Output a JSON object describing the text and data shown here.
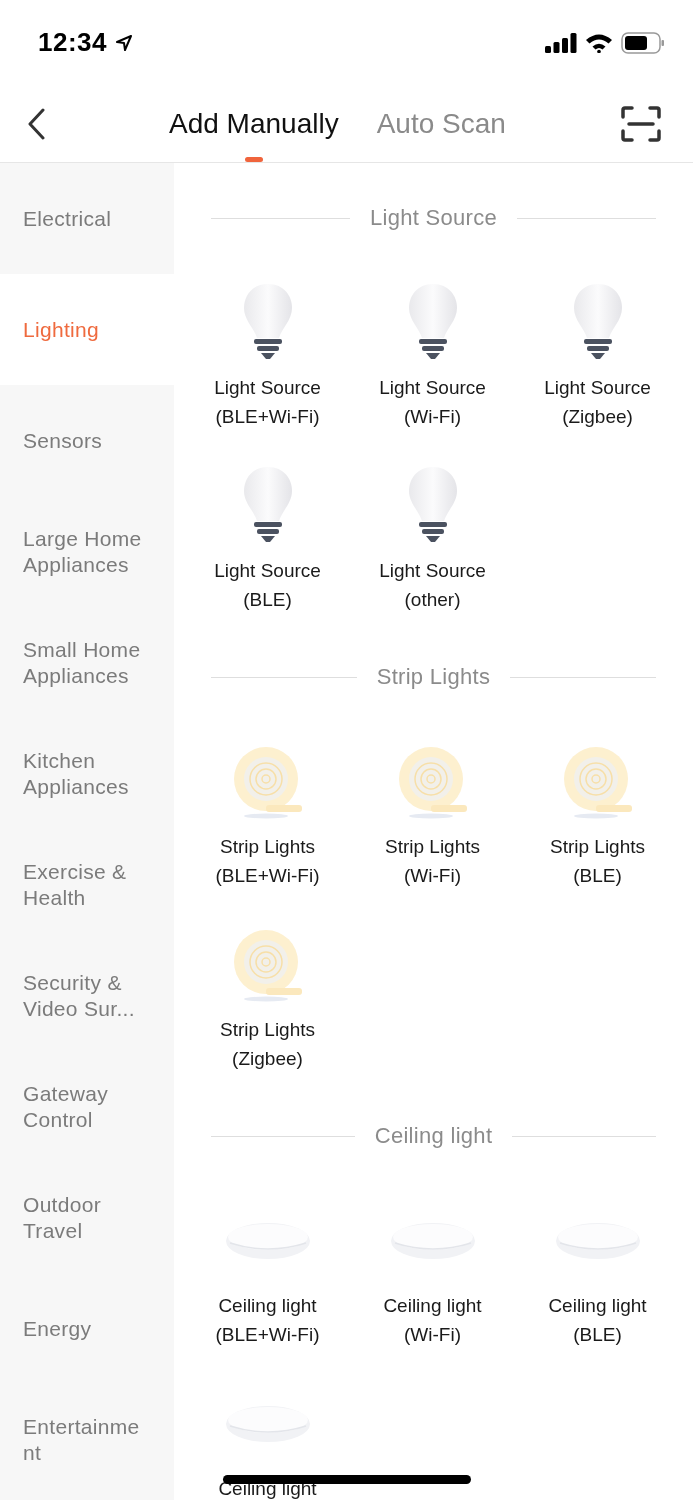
{
  "status_bar": {
    "time": "12:34"
  },
  "tabs": [
    {
      "label": "Add Manually",
      "selected": true
    },
    {
      "label": "Auto Scan",
      "selected": false
    }
  ],
  "sidebar": {
    "items": [
      {
        "label": "Electrical",
        "selected": false
      },
      {
        "label": "Lighting",
        "selected": true
      },
      {
        "label": "Sensors",
        "selected": false
      },
      {
        "label": "Large Home Appliances",
        "selected": false
      },
      {
        "label": "Small Home Appliances",
        "selected": false
      },
      {
        "label": "Kitchen Appliances",
        "selected": false
      },
      {
        "label": "Exercise & Health",
        "selected": false
      },
      {
        "label": "Security & Video Sur...",
        "selected": false
      },
      {
        "label": "Gateway Control",
        "selected": false
      },
      {
        "label": "Outdoor Travel",
        "selected": false
      },
      {
        "label": "Energy",
        "selected": false
      },
      {
        "label": "Entertainment",
        "selected": false
      }
    ]
  },
  "sections": [
    {
      "title": "Light Source",
      "kind": "bulb",
      "devices": [
        {
          "name": "Light Source",
          "variant": "(BLE+Wi-Fi)"
        },
        {
          "name": "Light Source",
          "variant": "(Wi-Fi)"
        },
        {
          "name": "Light Source",
          "variant": "(Zigbee)"
        },
        {
          "name": "Light Source",
          "variant": "(BLE)"
        },
        {
          "name": "Light Source",
          "variant": "(other)"
        }
      ]
    },
    {
      "title": "Strip Lights",
      "kind": "strip",
      "devices": [
        {
          "name": "Strip Lights",
          "variant": "(BLE+Wi-Fi)"
        },
        {
          "name": "Strip Lights",
          "variant": "(Wi-Fi)"
        },
        {
          "name": "Strip Lights",
          "variant": "(BLE)"
        },
        {
          "name": "Strip Lights",
          "variant": "(Zigbee)"
        }
      ]
    },
    {
      "title": "Ceiling light",
      "kind": "ceiling",
      "devices": [
        {
          "name": "Ceiling light",
          "variant": "(BLE+Wi-Fi)"
        },
        {
          "name": "Ceiling light",
          "variant": "(Wi-Fi)"
        },
        {
          "name": "Ceiling light",
          "variant": "(BLE)"
        },
        {
          "name": "Ceiling light"
        }
      ]
    }
  ]
}
